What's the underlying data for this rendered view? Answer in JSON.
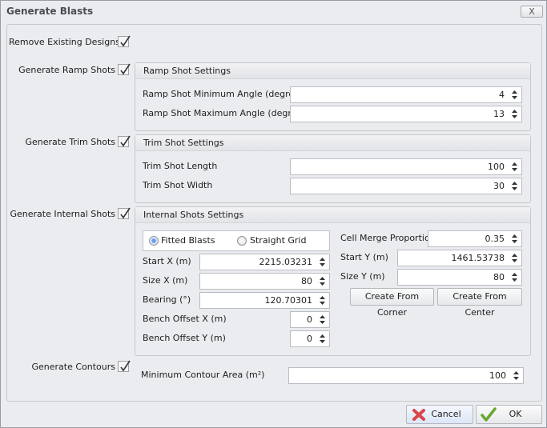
{
  "window": {
    "title": "Generate Blasts",
    "close_label": "X"
  },
  "remove_existing": {
    "label": "Remove Existing Designs",
    "checked": true
  },
  "ramp": {
    "label": "Generate Ramp Shots",
    "checked": true,
    "group_title": "Ramp Shot Settings",
    "min_label": "Ramp Shot Minimum Angle (degrees)",
    "min_value": "4",
    "max_label": "Ramp Shot Maximum Angle (degrees)",
    "max_value": "13"
  },
  "trim": {
    "label": "Generate Trim Shots",
    "checked": true,
    "group_title": "Trim Shot Settings",
    "length_label": "Trim Shot Length",
    "length_value": "100",
    "width_label": "Trim Shot Width",
    "width_value": "30"
  },
  "internal": {
    "label": "Generate Internal Shots",
    "checked": true,
    "group_title": "Internal Shots Settings",
    "radio_fitted": "Fitted Blasts",
    "radio_straight": "Straight Grid",
    "selected": "Fitted Blasts",
    "start_x_label": "Start X (m)",
    "start_x": "2215.03231",
    "size_x_label": "Size X (m)",
    "size_x": "80",
    "bearing_label": "Bearing (°)",
    "bearing": "120.70301",
    "bench_x_label": "Bench Offset X (m)",
    "bench_x": "0",
    "bench_y_label": "Bench Offset Y (m)",
    "bench_y": "0",
    "cell_merge_label": "Cell Merge Proportion",
    "cell_merge": "0.35",
    "start_y_label": "Start Y (m)",
    "start_y": "1461.53738",
    "size_y_label": "Size Y (m)",
    "size_y": "80",
    "corner_button": "Create From Corner",
    "center_button": "Create From Center"
  },
  "contours": {
    "label": "Generate Contours",
    "checked": true,
    "min_area_label": "Minimum Contour Area (m²)",
    "min_area": "100"
  },
  "footer": {
    "cancel": "Cancel",
    "ok": "OK"
  }
}
